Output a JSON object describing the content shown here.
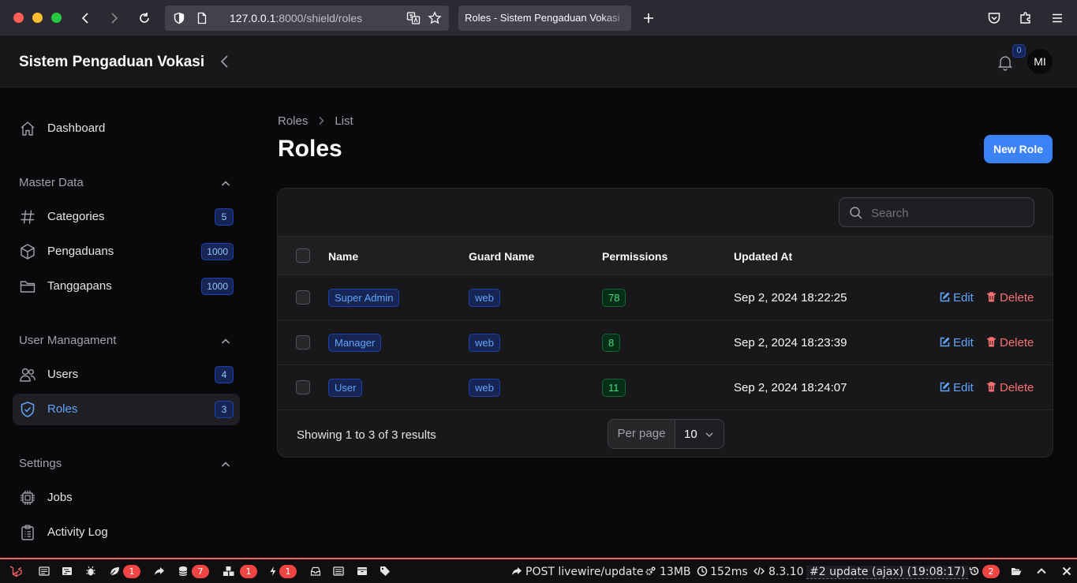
{
  "browser": {
    "url_host": "127.0.0.1",
    "url_path": ":8000/shield/roles",
    "tab_title": "Roles - Sistem Pengaduan Vokasi"
  },
  "app": {
    "brand": "Sistem Pengaduan Vokasi",
    "notifications_count": "0",
    "avatar_initials": "MI"
  },
  "sidebar": {
    "dashboard": "Dashboard",
    "groups": {
      "master": "Master Data",
      "user": "User Managament",
      "settings": "Settings"
    },
    "items": {
      "categories": {
        "label": "Categories",
        "count": "5"
      },
      "pengaduans": {
        "label": "Pengaduans",
        "count": "1000"
      },
      "tanggapans": {
        "label": "Tanggapans",
        "count": "1000"
      },
      "users": {
        "label": "Users",
        "count": "4"
      },
      "roles": {
        "label": "Roles",
        "count": "3"
      },
      "jobs": {
        "label": "Jobs"
      },
      "activity": {
        "label": "Activity Log"
      }
    },
    "active": "roles"
  },
  "page": {
    "breadcrumb": [
      "Roles",
      "List"
    ],
    "title": "Roles",
    "new_button": "New Role",
    "search_placeholder": "Search"
  },
  "table": {
    "columns": [
      "Name",
      "Guard Name",
      "Permissions",
      "Updated At"
    ],
    "rows": [
      {
        "name": "Super Admin",
        "guard": "web",
        "permissions": "78",
        "updated": "Sep 2, 2024 18:22:25"
      },
      {
        "name": "Manager",
        "guard": "web",
        "permissions": "8",
        "updated": "Sep 2, 2024 18:23:39"
      },
      {
        "name": "User",
        "guard": "web",
        "permissions": "11",
        "updated": "Sep 2, 2024 18:24:07"
      }
    ],
    "actions": {
      "edit": "Edit",
      "delete": "Delete"
    },
    "footer": "Showing 1 to 3 of 3 results",
    "per_page_label": "Per page",
    "per_page_value": "10"
  },
  "debugbar": {
    "badges": {
      "views": "1",
      "queries": "7",
      "models": "1",
      "events": "1",
      "history": "2"
    },
    "request": "POST livewire/update",
    "memory": "13MB",
    "time": "152ms",
    "php": "8.3.10",
    "current": "#2 update (ajax) (19:08:17)"
  },
  "colors": {
    "accent": "#3b82f6",
    "danger": "#f87171",
    "success": "#4ade80",
    "background": "#09090b"
  }
}
